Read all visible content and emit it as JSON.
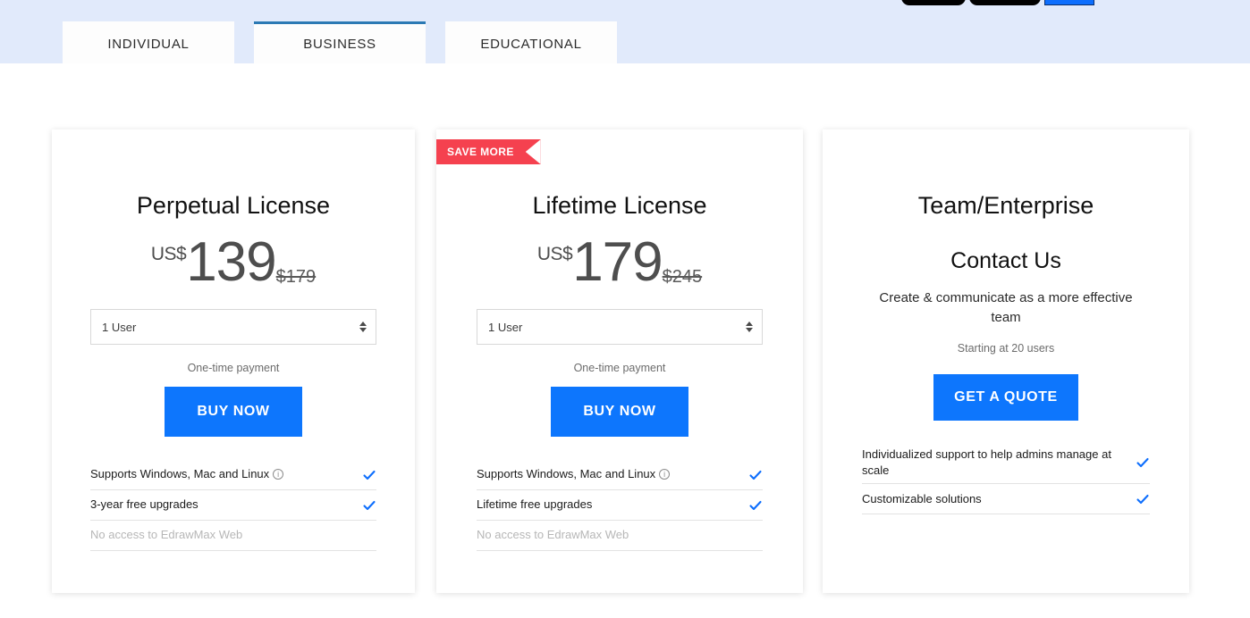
{
  "tabs": [
    {
      "label": "INDIVIDUAL",
      "active": false
    },
    {
      "label": "BUSINESS",
      "active": true
    },
    {
      "label": "EDUCATIONAL",
      "active": false
    }
  ],
  "colors": {
    "banner_bg": "#e1eafb",
    "accent_blue": "#0d76fd",
    "tab_active_border": "#2b79b4",
    "ribbon_red": "#f5414f",
    "check_blue": "#0d6efd",
    "muted_text": "#b7b7b7"
  },
  "cards": [
    {
      "title": "Perpetual License",
      "currency": "US$",
      "amount": "139",
      "old_price": "$179",
      "select_value": "1 User",
      "payment_note": "One-time payment",
      "cta_label": "BUY NOW",
      "features": [
        {
          "text": "Supports Windows, Mac and Linux",
          "info": true,
          "check": true,
          "muted": false
        },
        {
          "text": "3-year free upgrades",
          "info": false,
          "check": true,
          "muted": false
        },
        {
          "text": "No access to EdrawMax Web",
          "info": false,
          "check": false,
          "muted": true
        }
      ]
    },
    {
      "badge": "SAVE MORE",
      "title": "Lifetime License",
      "currency": "US$",
      "amount": "179",
      "old_price": "$245",
      "select_value": "1 User",
      "payment_note": "One-time payment",
      "cta_label": "BUY NOW",
      "features": [
        {
          "text": "Supports Windows, Mac and Linux",
          "info": true,
          "check": true,
          "muted": false
        },
        {
          "text": "Lifetime free upgrades",
          "info": false,
          "check": true,
          "muted": false
        },
        {
          "text": "No access to EdrawMax Web",
          "info": false,
          "check": false,
          "muted": true
        }
      ]
    },
    {
      "title": "Team/Enterprise",
      "contact_heading": "Contact Us",
      "subtitle": "Create & communicate as a more effective team",
      "note": "Starting at 20 users",
      "cta_label": "GET A QUOTE",
      "features": [
        {
          "text": "Individualized support to help admins manage at scale",
          "info": false,
          "check": true,
          "muted": false
        },
        {
          "text": "Customizable solutions",
          "info": false,
          "check": true,
          "muted": false
        }
      ]
    }
  ]
}
